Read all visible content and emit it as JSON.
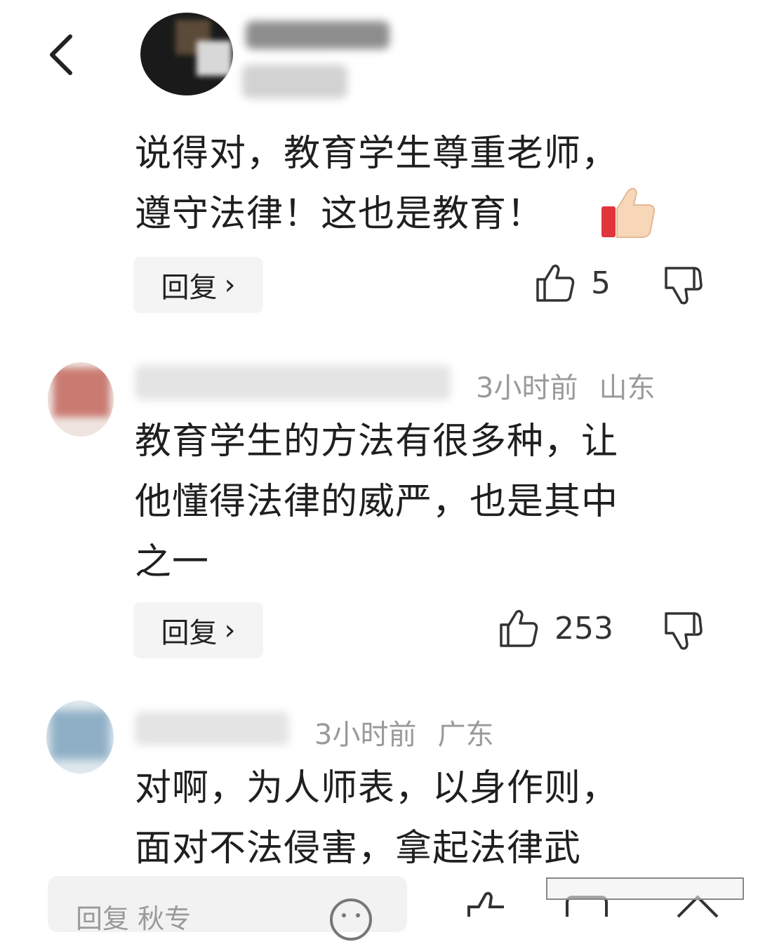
{
  "nav": {
    "back_icon": "chevron-left-icon"
  },
  "comments": [
    {
      "text_lines": [
        "说得对，教育学生尊重老师，",
        "遵守法律！这也是教育！"
      ],
      "emoji": "thumbs-up-emoji",
      "reply_label": "回复",
      "likes": "5"
    },
    {
      "time": "3小时前",
      "location": "山东",
      "text_lines": [
        "教育学生的方法有很多种，让",
        "他懂得法律的威严，也是其中",
        "之一"
      ],
      "reply_label": "回复",
      "likes": "253"
    },
    {
      "time": "3小时前",
      "location": "广东",
      "text_lines": [
        "对啊，为人师表，以身作则，",
        "面对不法侵害，拿起法律武"
      ]
    }
  ],
  "bottom_bar": {
    "placeholder": "回复 秋专"
  },
  "colors": {
    "meta_gray": "#9a9a9a",
    "reply_bg": "#f4f4f4",
    "text": "#1f1f1f"
  }
}
